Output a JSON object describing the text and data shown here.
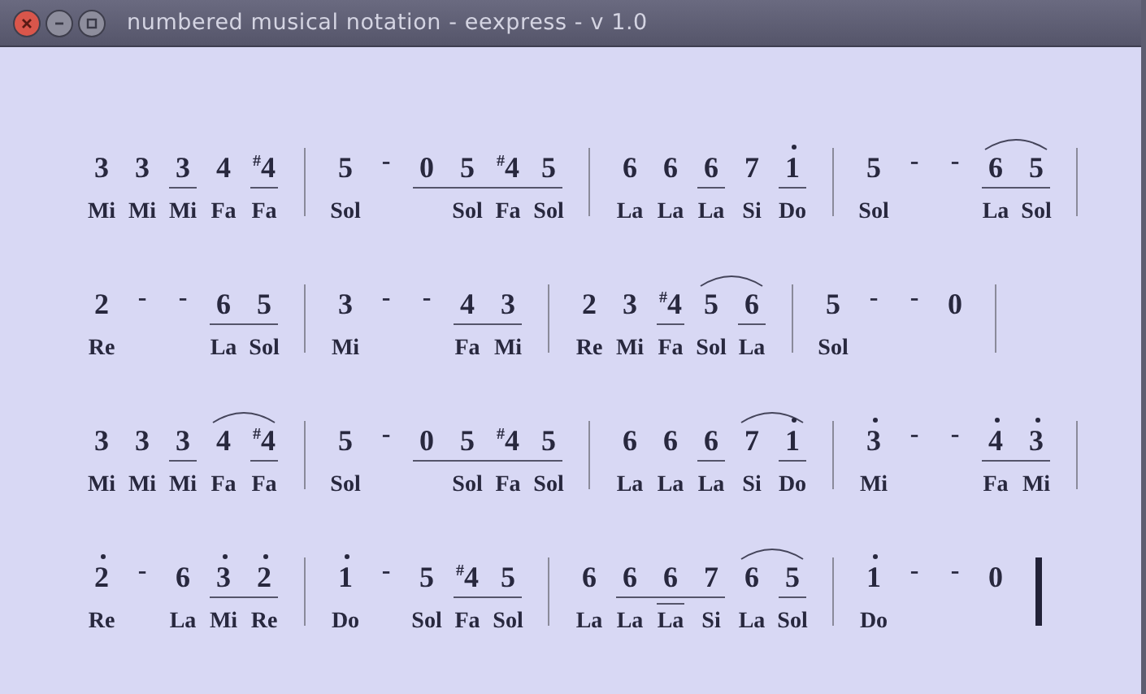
{
  "window": {
    "title": "numbered musical notation - eexpress - v 1.0"
  },
  "rows": [
    {
      "final_bar": false,
      "measures": [
        {
          "items": [
            {
              "kind": "note",
              "digit": "3",
              "lyric": "Mi"
            },
            {
              "kind": "note",
              "digit": "3",
              "lyric": "Mi"
            },
            {
              "kind": "beam",
              "items": [
                {
                  "kind": "note",
                  "digit": "3",
                  "lyric": "Mi"
                }
              ]
            },
            {
              "kind": "note",
              "digit": "4",
              "lyric": "Fa"
            },
            {
              "kind": "beam",
              "items": [
                {
                  "kind": "note",
                  "digit": "$^{#}$4",
                  "lyric": "Fa"
                }
              ]
            }
          ]
        },
        {
          "items": [
            {
              "kind": "note",
              "digit": "5",
              "lyric": "Sol"
            },
            {
              "kind": "dash",
              "digit": "-"
            },
            {
              "kind": "beam",
              "items": [
                {
                  "kind": "note",
                  "digit": "0"
                },
                {
                  "kind": "note",
                  "digit": "5",
                  "lyric": "Sol"
                },
                {
                  "kind": "note",
                  "digit": "$^{#}$4",
                  "lyric": "Fa"
                },
                {
                  "kind": "note",
                  "digit": "5",
                  "lyric": "Sol"
                }
              ]
            }
          ]
        },
        {
          "items": [
            {
              "kind": "note",
              "digit": "6",
              "lyric": "La"
            },
            {
              "kind": "note",
              "digit": "6",
              "lyric": "La"
            },
            {
              "kind": "beam",
              "items": [
                {
                  "kind": "note",
                  "digit": "6",
                  "lyric": "La"
                }
              ]
            },
            {
              "kind": "note",
              "digit": "7",
              "lyric": "Si"
            },
            {
              "kind": "beam",
              "items": [
                {
                  "kind": "high",
                  "digit": "1",
                  "lyric": "Do"
                }
              ]
            }
          ]
        },
        {
          "items": [
            {
              "kind": "note",
              "digit": "5",
              "lyric": "Sol"
            },
            {
              "kind": "dash",
              "digit": "-"
            },
            {
              "kind": "dash",
              "digit": "-"
            },
            {
              "kind": "beam",
              "items": [
                {
                  "kind": "slur",
                  "items": [
                    {
                      "kind": "note",
                      "digit": "6",
                      "lyric": "La"
                    },
                    {
                      "kind": "note",
                      "digit": "5",
                      "lyric": "Sol"
                    }
                  ]
                }
              ]
            }
          ]
        }
      ]
    },
    {
      "final_bar": false,
      "measures": [
        {
          "items": [
            {
              "kind": "note",
              "digit": "2",
              "lyric": "Re"
            },
            {
              "kind": "dash",
              "digit": "-"
            },
            {
              "kind": "dash",
              "digit": "-"
            },
            {
              "kind": "beam",
              "items": [
                {
                  "kind": "note",
                  "digit": "6",
                  "lyric": "La"
                },
                {
                  "kind": "note",
                  "digit": "5",
                  "lyric": "Sol"
                }
              ]
            }
          ]
        },
        {
          "items": [
            {
              "kind": "note",
              "digit": "3",
              "lyric": "Mi"
            },
            {
              "kind": "dash",
              "digit": "-"
            },
            {
              "kind": "dash",
              "digit": "-"
            },
            {
              "kind": "beam",
              "items": [
                {
                  "kind": "note",
                  "digit": "4",
                  "lyric": "Fa"
                },
                {
                  "kind": "note",
                  "digit": "3",
                  "lyric": "Mi"
                }
              ]
            }
          ]
        },
        {
          "items": [
            {
              "kind": "note",
              "digit": "2",
              "lyric": "Re"
            },
            {
              "kind": "note",
              "digit": "3",
              "lyric": "Mi"
            },
            {
              "kind": "beam",
              "items": [
                {
                  "kind": "note",
                  "digit": "$^{#}$4",
                  "lyric": "Fa"
                }
              ]
            },
            {
              "kind": "slur",
              "items": [
                {
                  "kind": "note",
                  "digit": "5",
                  "lyric": "Sol"
                },
                {
                  "kind": "beam",
                  "items": [
                    {
                      "kind": "note",
                      "digit": "6",
                      "lyric": "La"
                    }
                  ]
                }
              ]
            }
          ]
        },
        {
          "items": [
            {
              "kind": "note",
              "digit": "5",
              "lyric": "Sol"
            },
            {
              "kind": "dash",
              "digit": "-"
            },
            {
              "kind": "dash",
              "digit": "-"
            },
            {
              "kind": "note",
              "digit": "0"
            }
          ]
        }
      ]
    },
    {
      "final_bar": false,
      "measures": [
        {
          "items": [
            {
              "kind": "note",
              "digit": "3",
              "lyric": "Mi"
            },
            {
              "kind": "note",
              "digit": "3",
              "lyric": "Mi"
            },
            {
              "kind": "beam",
              "items": [
                {
                  "kind": "note",
                  "digit": "3",
                  "lyric": "Mi"
                }
              ]
            },
            {
              "kind": "slur",
              "items": [
                {
                  "kind": "note",
                  "digit": "4",
                  "lyric": "Fa"
                },
                {
                  "kind": "beam",
                  "items": [
                    {
                      "kind": "note",
                      "digit": "$^{#}$4",
                      "lyric": "Fa"
                    }
                  ]
                }
              ]
            }
          ]
        },
        {
          "items": [
            {
              "kind": "note",
              "digit": "5",
              "lyric": "Sol"
            },
            {
              "kind": "dash",
              "digit": "-"
            },
            {
              "kind": "beam",
              "items": [
                {
                  "kind": "note",
                  "digit": "0"
                },
                {
                  "kind": "note",
                  "digit": "5",
                  "lyric": "Sol"
                },
                {
                  "kind": "note",
                  "digit": "$^{#}$4",
                  "lyric": "Fa"
                },
                {
                  "kind": "note",
                  "digit": "5",
                  "lyric": "Sol"
                }
              ]
            }
          ]
        },
        {
          "items": [
            {
              "kind": "note",
              "digit": "6",
              "lyric": "La"
            },
            {
              "kind": "note",
              "digit": "6",
              "lyric": "La"
            },
            {
              "kind": "beam",
              "items": [
                {
                  "kind": "note",
                  "digit": "6",
                  "lyric": "La"
                }
              ]
            },
            {
              "kind": "slur",
              "items": [
                {
                  "kind": "note",
                  "digit": "7",
                  "lyric": "Si"
                },
                {
                  "kind": "beam",
                  "items": [
                    {
                      "kind": "high",
                      "digit": "1",
                      "lyric": "Do"
                    }
                  ]
                }
              ]
            }
          ]
        },
        {
          "items": [
            {
              "kind": "high",
              "digit": "3",
              "lyric": "Mi"
            },
            {
              "kind": "dash",
              "digit": "-"
            },
            {
              "kind": "dash",
              "digit": "-"
            },
            {
              "kind": "beam",
              "items": [
                {
                  "kind": "high",
                  "digit": "4",
                  "lyric": "Fa"
                },
                {
                  "kind": "high",
                  "digit": "3",
                  "lyric": "Mi"
                }
              ]
            }
          ]
        }
      ]
    },
    {
      "final_bar": true,
      "measures": [
        {
          "items": [
            {
              "kind": "high",
              "digit": "2",
              "lyric": "Re"
            },
            {
              "kind": "dash",
              "digit": "-"
            },
            {
              "kind": "note",
              "digit": "6",
              "lyric": "La"
            },
            {
              "kind": "beam",
              "items": [
                {
                  "kind": "high",
                  "digit": "3",
                  "lyric": "Mi"
                },
                {
                  "kind": "high",
                  "digit": "2",
                  "lyric": "Re"
                }
              ]
            }
          ]
        },
        {
          "items": [
            {
              "kind": "high",
              "digit": "1",
              "lyric": "Do"
            },
            {
              "kind": "dash",
              "digit": "-"
            },
            {
              "kind": "note",
              "digit": "5",
              "lyric": "Sol"
            },
            {
              "kind": "beam",
              "items": [
                {
                  "kind": "note",
                  "digit": "$^{#}$4",
                  "lyric": "Fa"
                },
                {
                  "kind": "note",
                  "digit": "5",
                  "lyric": "Sol"
                }
              ]
            }
          ]
        },
        {
          "items": [
            {
              "kind": "note",
              "digit": "6",
              "lyric": "La"
            },
            {
              "kind": "beam",
              "items": [
                {
                  "kind": "note",
                  "digit": "6",
                  "lyric": "La"
                },
                {
                  "kind": "beam",
                  "items": [
                    {
                      "kind": "note",
                      "digit": "6",
                      "lyric": "La"
                    }
                  ]
                },
                {
                  "kind": "note",
                  "digit": "7",
                  "lyric": "Si"
                }
              ]
            },
            {
              "kind": "slur",
              "items": [
                {
                  "kind": "note",
                  "digit": "6",
                  "lyric": "La"
                },
                {
                  "kind": "beam",
                  "items": [
                    {
                      "kind": "note",
                      "digit": "5",
                      "lyric": "Sol"
                    }
                  ]
                }
              ]
            }
          ]
        },
        {
          "items": [
            {
              "kind": "high",
              "digit": "1",
              "lyric": "Do"
            },
            {
              "kind": "dash",
              "digit": "-"
            },
            {
              "kind": "dash",
              "digit": "-"
            },
            {
              "kind": "note",
              "digit": "0"
            }
          ]
        }
      ]
    }
  ]
}
